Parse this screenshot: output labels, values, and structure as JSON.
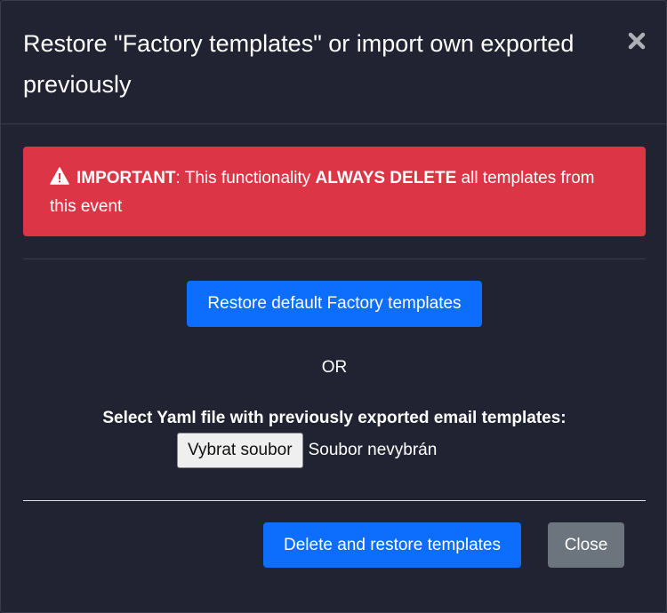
{
  "modal": {
    "title": "Restore \"Factory templates\" or import own exported previously",
    "close_icon": "close-x-icon"
  },
  "alert": {
    "icon": "warning-triangle-icon",
    "color": "#dc3545",
    "important": "IMPORTANT",
    "text_part1": ": This functionality ",
    "emphasis": "ALWAYS DELETE",
    "text_part2": " all templates from this event"
  },
  "restore_button": {
    "label": "Restore default Factory templates"
  },
  "or_text": "OR",
  "file_upload": {
    "label": "Select Yaml file with previously exported email templates:",
    "button_label": "Vybrat soubor",
    "status": "Soubor nevybrán"
  },
  "footer": {
    "delete_restore_label": "Delete and restore templates",
    "close_label": "Close"
  },
  "colors": {
    "background": "#212332",
    "primary": "#0d6efd",
    "secondary": "#6c757d",
    "danger": "#dc3545"
  }
}
